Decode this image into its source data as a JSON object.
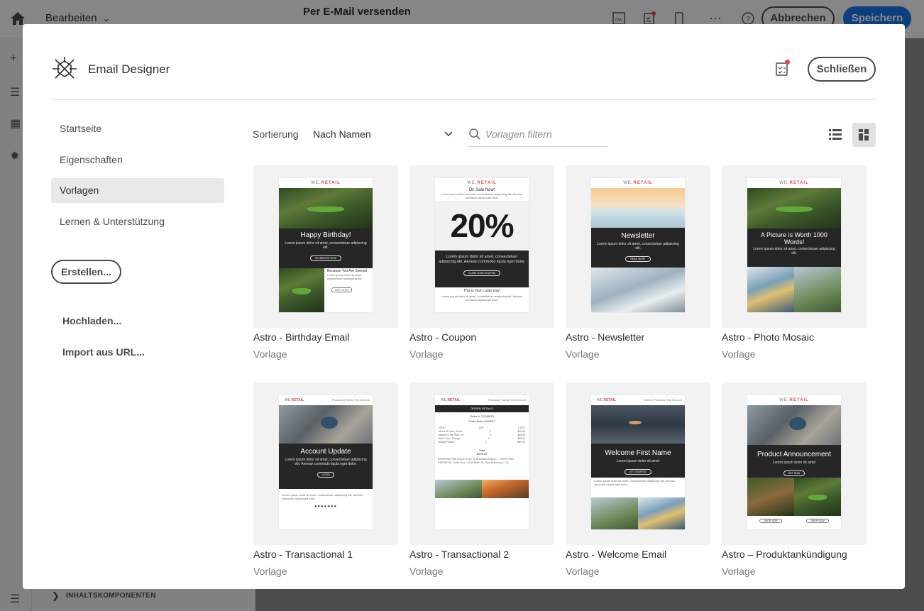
{
  "app": {
    "edit_menu": "Bearbeiten",
    "title": "Per E-Mail versenden",
    "cancel_label": "Abbrechen",
    "save_label": "Speichern",
    "bottom_panel": "INHALTSKOMPONENTEN"
  },
  "modal": {
    "title": "Email Designer",
    "close_label": "Schließen",
    "nav": [
      {
        "label": "Startseite",
        "active": false
      },
      {
        "label": "Eigenschaften",
        "active": false
      },
      {
        "label": "Vorlagen",
        "active": true
      },
      {
        "label": "Lernen & Unterstützung",
        "active": false
      }
    ],
    "create_label": "Erstellen...",
    "upload_label": "Hochladen...",
    "import_label": "Import aus URL..."
  },
  "toolbar": {
    "sort_label": "Sortierung",
    "sort_value": "Nach Namen",
    "search_placeholder": "Vorlagen filtern",
    "active_view": "grid"
  },
  "brand": {
    "we": "WE.",
    "retail": "RETAIL",
    "accent": "#e34850"
  },
  "templates": [
    {
      "name": "Astro - Birthday Email",
      "type": "Vorlage",
      "heading": "Happy Birthday!",
      "body": "Lorem ipsum dolor sit amet, consectetuer adipiscing elit.",
      "button": "CELEBRATE NOW",
      "sub": "Because You Are Special",
      "cta": "GET NOW"
    },
    {
      "name": "Astro - Coupon",
      "type": "Vorlage",
      "top": "On Sale Now!",
      "big": "20%",
      "body": "Lorem ipsum dolor sit amet, consectetuer adipiscing elit. Aenean commodo ligula eget dolor.",
      "button": "CLAIM YOUR COUPON",
      "sub": "This is Your Lucky Day!"
    },
    {
      "name": "Astro - Newsletter",
      "type": "Vorlage",
      "heading": "Newsletter",
      "body": "Lorem ipsum dolor sit amet, consectetuer adipiscing elit.",
      "button": "READ MORE"
    },
    {
      "name": "Astro - Photo Mosaic",
      "type": "Vorlage",
      "heading": "A Picture is Worth 1000 Words!",
      "body": "Lorem ipsum dolor sit amet, consectetuer adipiscing elit."
    },
    {
      "name": "Astro - Transactional 1",
      "type": "Vorlage",
      "heading": "Account Update",
      "body": "Lorem ipsum dolor sit amet, consectetuer adipiscing elit. Aenean commodo ligula eget dolor.",
      "button": "LOGIN",
      "links": "Products | News | My Account"
    },
    {
      "name": "Astro - Transactional 2",
      "type": "Vorlage",
      "header": "ORDER DETAILS",
      "links": "Products | News | My Account",
      "order": "Order #: 12345678",
      "date": "Order Date: 6/5/2017",
      "total": "Total",
      "amount": "$295.00"
    },
    {
      "name": "Astro - Welcome Email",
      "type": "Vorlage",
      "heading": "Welcome First Name",
      "body": "Lorem ipsum dolor sit amet",
      "button": "GET STARTED",
      "links": "News | Products | My Account"
    },
    {
      "name": "Astro – Produktankündigung",
      "type": "Vorlage",
      "heading": "Product Announcement",
      "body": "Lorem ipsum dolor sit amet",
      "button": "GET NOW",
      "cta": "SHOP NOW"
    }
  ]
}
